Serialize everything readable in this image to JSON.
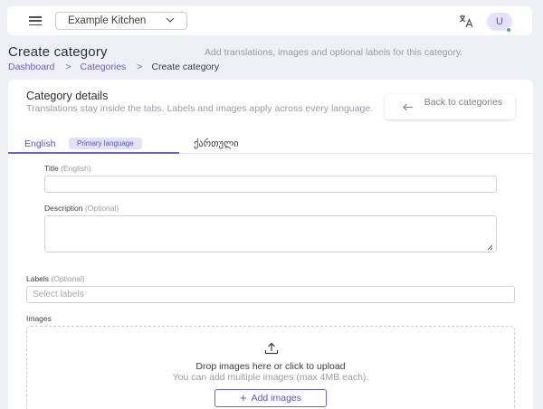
{
  "topbar": {
    "kitchen_name": "Example Kitchen",
    "avatar_initial": "U",
    "language_icon": "translate-icon",
    "status_color": "#35b66c"
  },
  "header": {
    "title": "Create category",
    "subtitle": "Add translations, images and optional labels for this category.",
    "breadcrumb": [
      "Dashboard",
      "Categories",
      "Create category"
    ]
  },
  "card": {
    "title": "Category details",
    "subtitle": "Translations stay inside the tabs. Labels and images apply across every language.",
    "back_button": "Back to categories"
  },
  "tabs": {
    "english": "English",
    "primary_badge": "Primary language",
    "georgian": "ქართული"
  },
  "form": {
    "title_label": "Title",
    "title_hint": "(English)",
    "title_value": "",
    "description_label": "Description",
    "description_hint": "(Optional)",
    "description_value": "",
    "labels_label": "Labels",
    "labels_hint": "(Optional)",
    "labels_placeholder": "Select labels",
    "images_label": "Images"
  },
  "upload": {
    "title": "Drop images here or click to upload",
    "subtitle": "You can add multiple images (max 4MB each).",
    "button": "Add images"
  },
  "colors": {
    "accent": "#6a5ed8",
    "background": "#eef0f3"
  }
}
